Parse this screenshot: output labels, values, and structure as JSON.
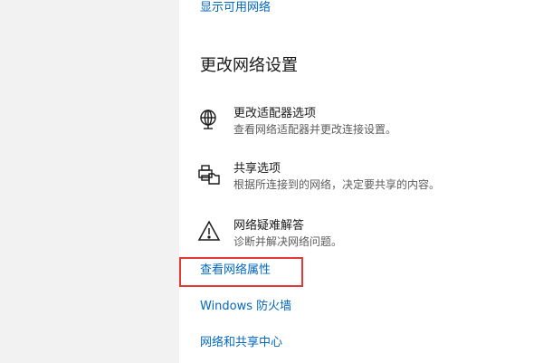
{
  "links": {
    "show_available": "显示可用网络",
    "view_properties": "查看网络属性",
    "firewall": "Windows 防火墙",
    "sharing_center": "网络和共享中心"
  },
  "section": {
    "title": "更改网络设置"
  },
  "settings": [
    {
      "title": "更改适配器选项",
      "desc": "查看网络适配器并更改连接设置。",
      "icon": "adapter-globe-icon"
    },
    {
      "title": "共享选项",
      "desc": "根据所连接到的网络，决定要共享的内容。",
      "icon": "sharing-printer-icon"
    },
    {
      "title": "网络疑难解答",
      "desc": "诊断并解决网络问题。",
      "icon": "warning-triangle-icon"
    }
  ],
  "colors": {
    "link": "#0067c0",
    "highlight": "#e53935",
    "sidebar": "#f2f2f2"
  }
}
